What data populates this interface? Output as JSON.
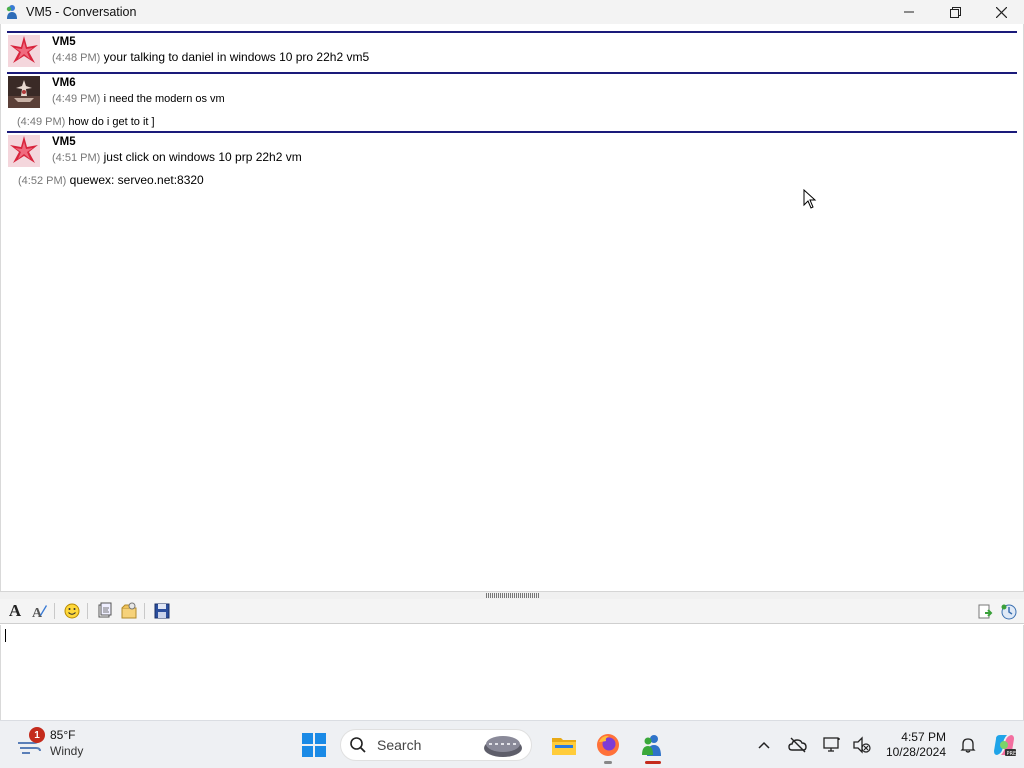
{
  "window": {
    "title": "VM5 - Conversation",
    "controls": {
      "minimize": "—",
      "restore": "❐",
      "close": "✕"
    }
  },
  "conversation": {
    "messages": [
      {
        "sender": "VM5",
        "avatar": "red-star-avatar",
        "lines": [
          {
            "time": "(4:48 PM)",
            "text": "your talking to daniel in windows 10 pro 22h2 vm5"
          }
        ]
      },
      {
        "sender": "VM6",
        "avatar": "pagoda-avatar",
        "lines": [
          {
            "time": "(4:49 PM)",
            "text": "i need the modern os vm"
          }
        ],
        "extra": {
          "time": "(4:49 PM)",
          "text": "how do i get to it ]"
        }
      },
      {
        "sender": "VM5",
        "avatar": "red-star-avatar",
        "lines": [
          {
            "time": "(4:51 PM)",
            "text": "just click on windows 10 prp 22h2 vm"
          }
        ]
      }
    ],
    "standalone": {
      "time": "(4:52 PM)",
      "text": "quewex: serveo.net:8320"
    }
  },
  "toolbar": {
    "left_icons": [
      "font-icon",
      "font-style-icon",
      "emoticon-icon",
      "wink-icon",
      "nudge-icon",
      "save-icon"
    ],
    "right_icons": [
      "send-file-icon",
      "activities-icon"
    ]
  },
  "input": {
    "value": ""
  },
  "taskbar": {
    "weather": {
      "temp": "85°F",
      "condition": "Windy",
      "badge": "1"
    },
    "search": {
      "label": "Search"
    },
    "apps": [
      "file-explorer-icon",
      "firefox-icon",
      "messenger-icon"
    ],
    "clock": {
      "time": "4:57 PM",
      "date": "10/28/2024"
    }
  },
  "colors": {
    "separator": "#1a1a7a",
    "timestamp": "#777777",
    "taskbar_bg": "#eef0f3",
    "accent_red": "#c42b1c"
  }
}
